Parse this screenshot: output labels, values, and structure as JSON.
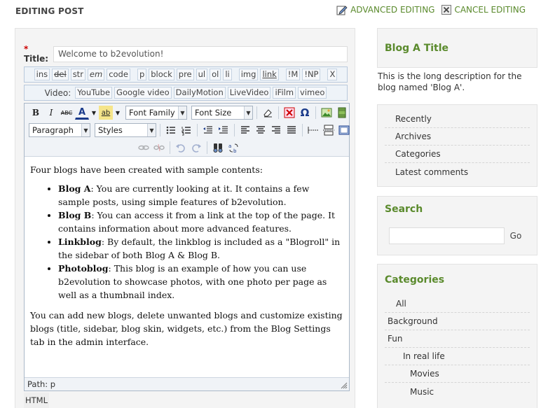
{
  "header": {
    "title": "EDITING POST",
    "advanced_editing": "ADVANCED EDITING",
    "cancel_editing": "CANCEL EDITING"
  },
  "form": {
    "title_label": "Title:",
    "required_mark": "*",
    "title_value": "Welcome to b2evolution!"
  },
  "quicktags": [
    "ins",
    "del",
    "str",
    "em",
    "code",
    "p",
    "block",
    "pre",
    "ul",
    "ol",
    "li",
    "img",
    "link",
    "!M",
    "!NP",
    "X"
  ],
  "video": {
    "label": "Video:",
    "buttons": [
      "YouTube",
      "Google video",
      "DailyMotion",
      "LiveVideo",
      "iFilm",
      "vimeo"
    ]
  },
  "toolbar": {
    "font_family": "Font Family",
    "font_size": "Font Size",
    "format": "Paragraph",
    "styles": "Styles",
    "icons": {
      "bold": "B",
      "italic": "I",
      "strike": "ABC",
      "text_color": "A",
      "bg_color": "ab"
    }
  },
  "content": {
    "intro": "Four blogs have been created with sample contents:",
    "items": [
      {
        "name": "Blog A",
        "text": ": You are currently looking at it. It contains a few sample posts, using simple features of b2evolution."
      },
      {
        "name": "Blog B",
        "text": ": You can access it from a link at the top of the page. It contains information about more advanced features."
      },
      {
        "name": "Linkblog",
        "text": ": By default, the linkblog is included as a \"Blogroll\" in the sidebar of both Blog A & Blog B."
      },
      {
        "name": "Photoblog",
        "text": ": This blog is an example of how you can use b2evolution to showcase photos, with one photo per page as well as a thumbnail index."
      }
    ],
    "outro": "You can add new blogs, delete unwanted blogs and customize existing blogs (title, sidebar, blog skin, widgets, etc.) from the Blog Settings tab in the admin interface."
  },
  "statusbar": {
    "path": "Path: p"
  },
  "html_tab": "HTML",
  "sidebar": {
    "blog_title": "Blog A Title",
    "blog_desc": "This is the long description for the blog named 'Blog A'.",
    "links": [
      "Recently",
      "Archives",
      "Categories",
      "Latest comments"
    ],
    "search_title": "Search",
    "search_button": "Go",
    "categories_title": "Categories",
    "categories": [
      {
        "label": "All",
        "level": 0
      },
      {
        "label": "Background",
        "level": 0
      },
      {
        "label": "Fun",
        "level": 0
      },
      {
        "label": "In real life",
        "level": 1
      },
      {
        "label": "Movies",
        "level": 2
      },
      {
        "label": "Music",
        "level": 2
      }
    ]
  },
  "colors": {
    "accent": "#5a8a2c"
  }
}
